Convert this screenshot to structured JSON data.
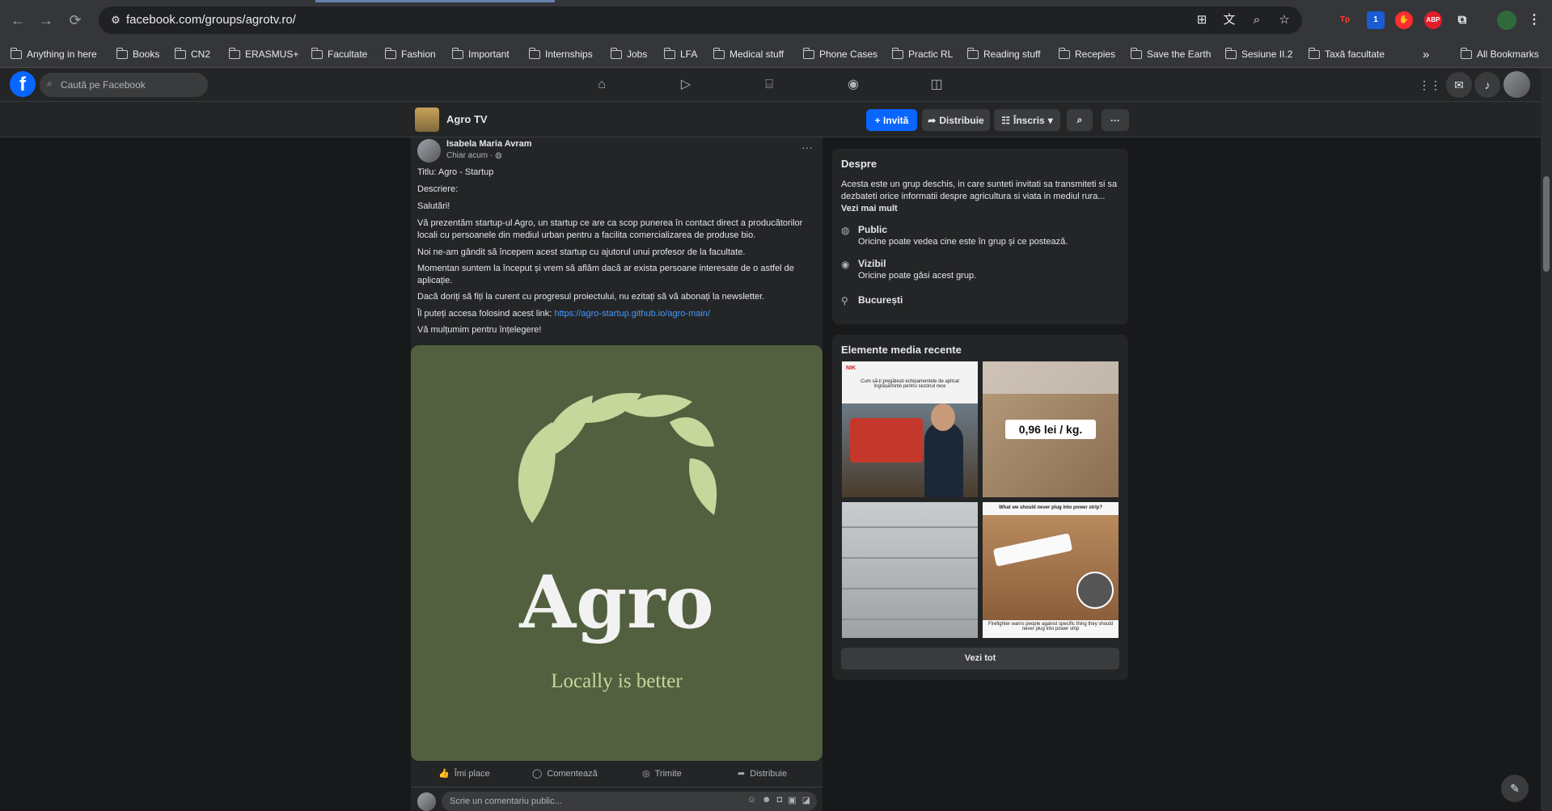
{
  "browser": {
    "url": "facebook.com/groups/agrotv.ro/",
    "bookmarks": [
      "Anything in here",
      "Books",
      "CN2",
      "ERASMUS+",
      "Facultate",
      "Fashion",
      "Important",
      "Internships",
      "Jobs",
      "LFA",
      "Medical stuff",
      "Phone Cases",
      "Practic RL",
      "Reading stuff",
      "Recepies",
      "Save the Earth",
      "Sesiune II.2",
      "Taxă facultate"
    ],
    "all_bookmarks": "All Bookmarks",
    "more_bookmarks": "»",
    "extensions": {
      "tp": "Tp",
      "one": "1",
      "abp": "ABP"
    }
  },
  "facebook": {
    "logo": "f",
    "search_placeholder": "Caută pe Facebook"
  },
  "group": {
    "title": "Agro TV",
    "invite": "+ Invită",
    "share": "Distribuie",
    "joined": "Înscris"
  },
  "post": {
    "author": "Isabela Maria Avram",
    "time": "Chiar acum · ◍",
    "lines": [
      "Titlu: Agro - Startup",
      "Descriere:",
      "Salutări!",
      "Vă prezentăm startup-ul Agro, un startup ce are ca scop punerea în contact direct a producătorilor locali cu persoanele din mediul urban pentru a facilita comercializarea de produse bio.",
      "Noi ne-am gândit să începem acest startup cu ajutorul unui profesor de la facultate.",
      "Momentan suntem la început și vrem să aflăm dacă ar exista persoane interesate de o astfel de aplicație.",
      "Dacă doriți să fiți la curent cu progresul proiectului, nu ezitați să vă abonați la newsletter."
    ],
    "link_prefix": "Îl puteți accesa folosind acest link: ",
    "link": "https://agro-startup.github.io/agro-main/",
    "thanks": "Vă mulțumim pentru înțelegere!",
    "image_word": "Agro",
    "image_tagline": "Locally is better",
    "actions": {
      "like": "Îmi place",
      "comment": "Comentează",
      "send": "Trimite",
      "share": "Distribuie"
    },
    "comment_placeholder": "Scrie un comentariu public..."
  },
  "about": {
    "title": "Despre",
    "text": "Acesta este un grup deschis, in care sunteti invitati sa transmiteti si sa dezbateti orice informatii despre agricultura si viata in mediul rura...",
    "more": "Vezi mai mult",
    "public_title": "Public",
    "public_sub": "Oricine poate vedea cine este în grup și ce postează.",
    "visible_title": "Vizibil",
    "visible_sub": "Oricine poate găsi acest grup.",
    "location": "București"
  },
  "media": {
    "title": "Elemente media recente",
    "tile1_brand": "NIK",
    "tile1_caption": "Cum să-ți pregătești echipamentele de aplicat îngrășăminte pentru sezonul rece",
    "price": "0,96 lei / kg.",
    "tile4_heading": "What we should never plug into power strip?",
    "tile4_caption": "Firefighter warns people against specific thing they should never plug into power strip",
    "see_all": "Vezi tot"
  }
}
